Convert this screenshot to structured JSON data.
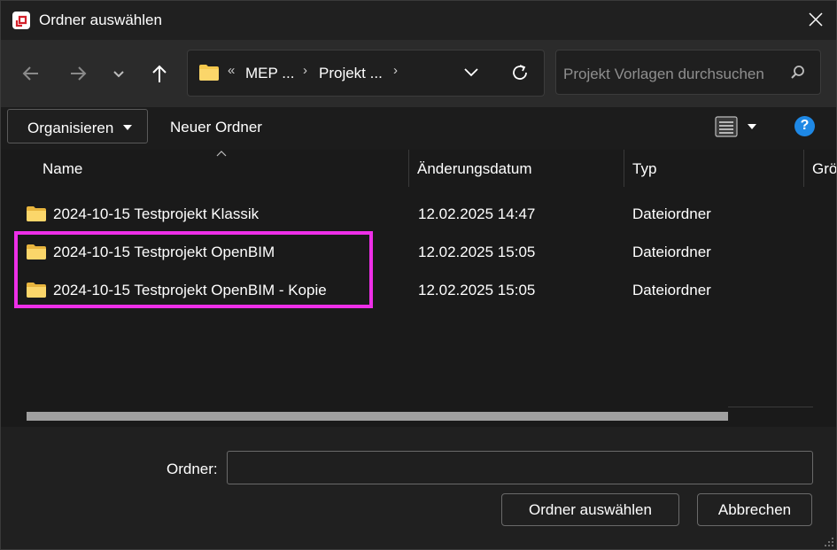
{
  "window": {
    "title": "Ordner auswählen"
  },
  "navbar": {
    "breadcrumb": [
      "MEP ...",
      "Projekt ..."
    ],
    "breadcrumb_overflow": "«",
    "search_placeholder": "Projekt Vorlagen durchsuchen"
  },
  "toolbar": {
    "organize_label": "Organisieren",
    "new_folder_label": "Neuer Ordner",
    "help_label": "?"
  },
  "columns": [
    "Name",
    "Änderungsdatum",
    "Typ",
    "Grö"
  ],
  "files": [
    {
      "name": "2024-10-15 Testprojekt Klassik",
      "modified": "12.02.2025 14:47",
      "type": "Dateiordner"
    },
    {
      "name": "2024-10-15 Testprojekt OpenBIM",
      "modified": "12.02.2025 15:05",
      "type": "Dateiordner"
    },
    {
      "name": "2024-10-15 Testprojekt OpenBIM - Kopie",
      "modified": "12.02.2025 15:05",
      "type": "Dateiordner"
    }
  ],
  "bottom": {
    "folder_label": "Ordner:",
    "folder_value": "",
    "select_button": "Ordner auswählen",
    "cancel_button": "Abbrechen"
  },
  "colors": {
    "highlight": "#ee2fe8",
    "help": "#1e88e5",
    "folder": "#f5c84c"
  }
}
